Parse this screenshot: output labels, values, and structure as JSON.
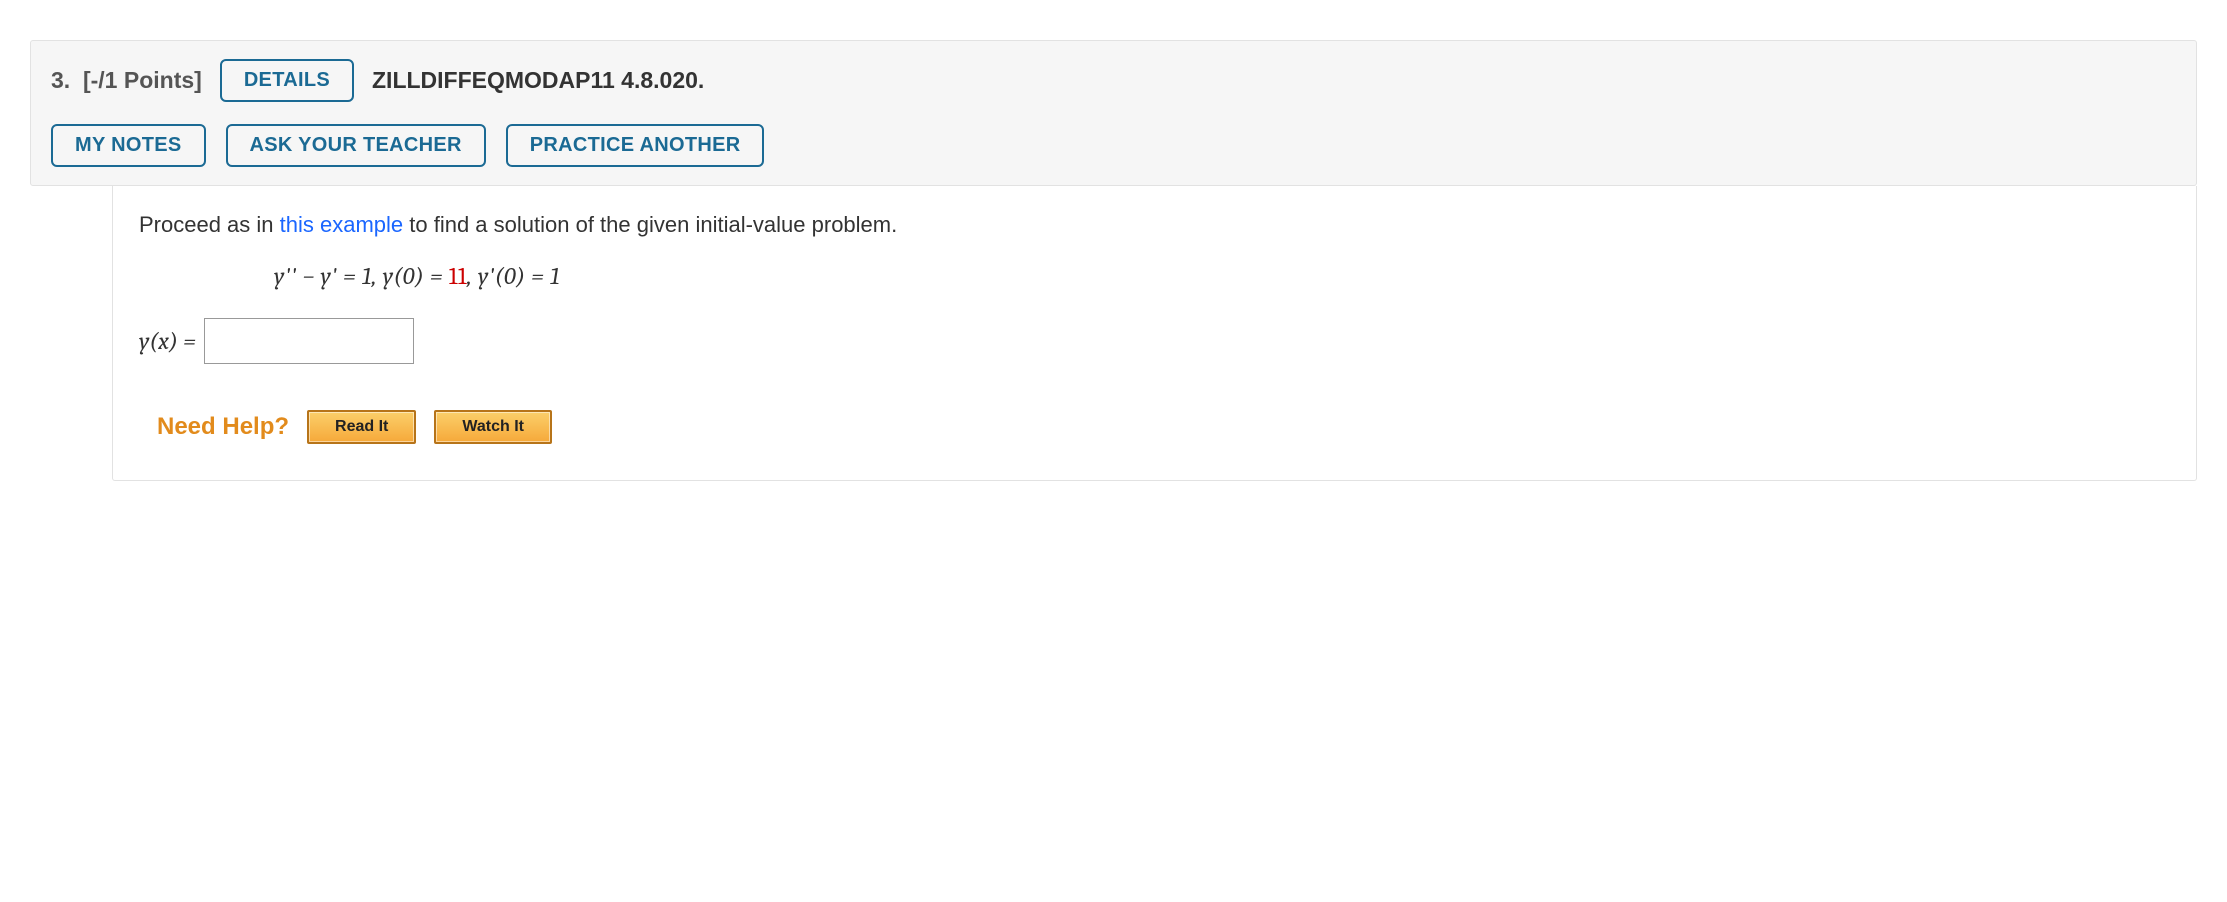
{
  "header": {
    "question_number": "3.",
    "points": "[-/1 Points]",
    "details_button": "DETAILS",
    "textbook_ref": "ZILLDIFFEQMODAP11 4.8.020.",
    "my_notes": "MY NOTES",
    "ask_teacher": "ASK YOUR TEACHER",
    "practice_another": "PRACTICE ANOTHER"
  },
  "body": {
    "instruction_pre": "Proceed as in ",
    "example_link": "this example",
    "instruction_post": " to find a solution of the given initial-value problem.",
    "equation": {
      "part1": "y'' − y' = 1, y(0) = ",
      "red": "11",
      "part2": ", y'(0) = 1"
    },
    "answer_label": "y(x) = ",
    "answer_value": "",
    "need_help": "Need Help?",
    "read_it": "Read It",
    "watch_it": "Watch It"
  }
}
